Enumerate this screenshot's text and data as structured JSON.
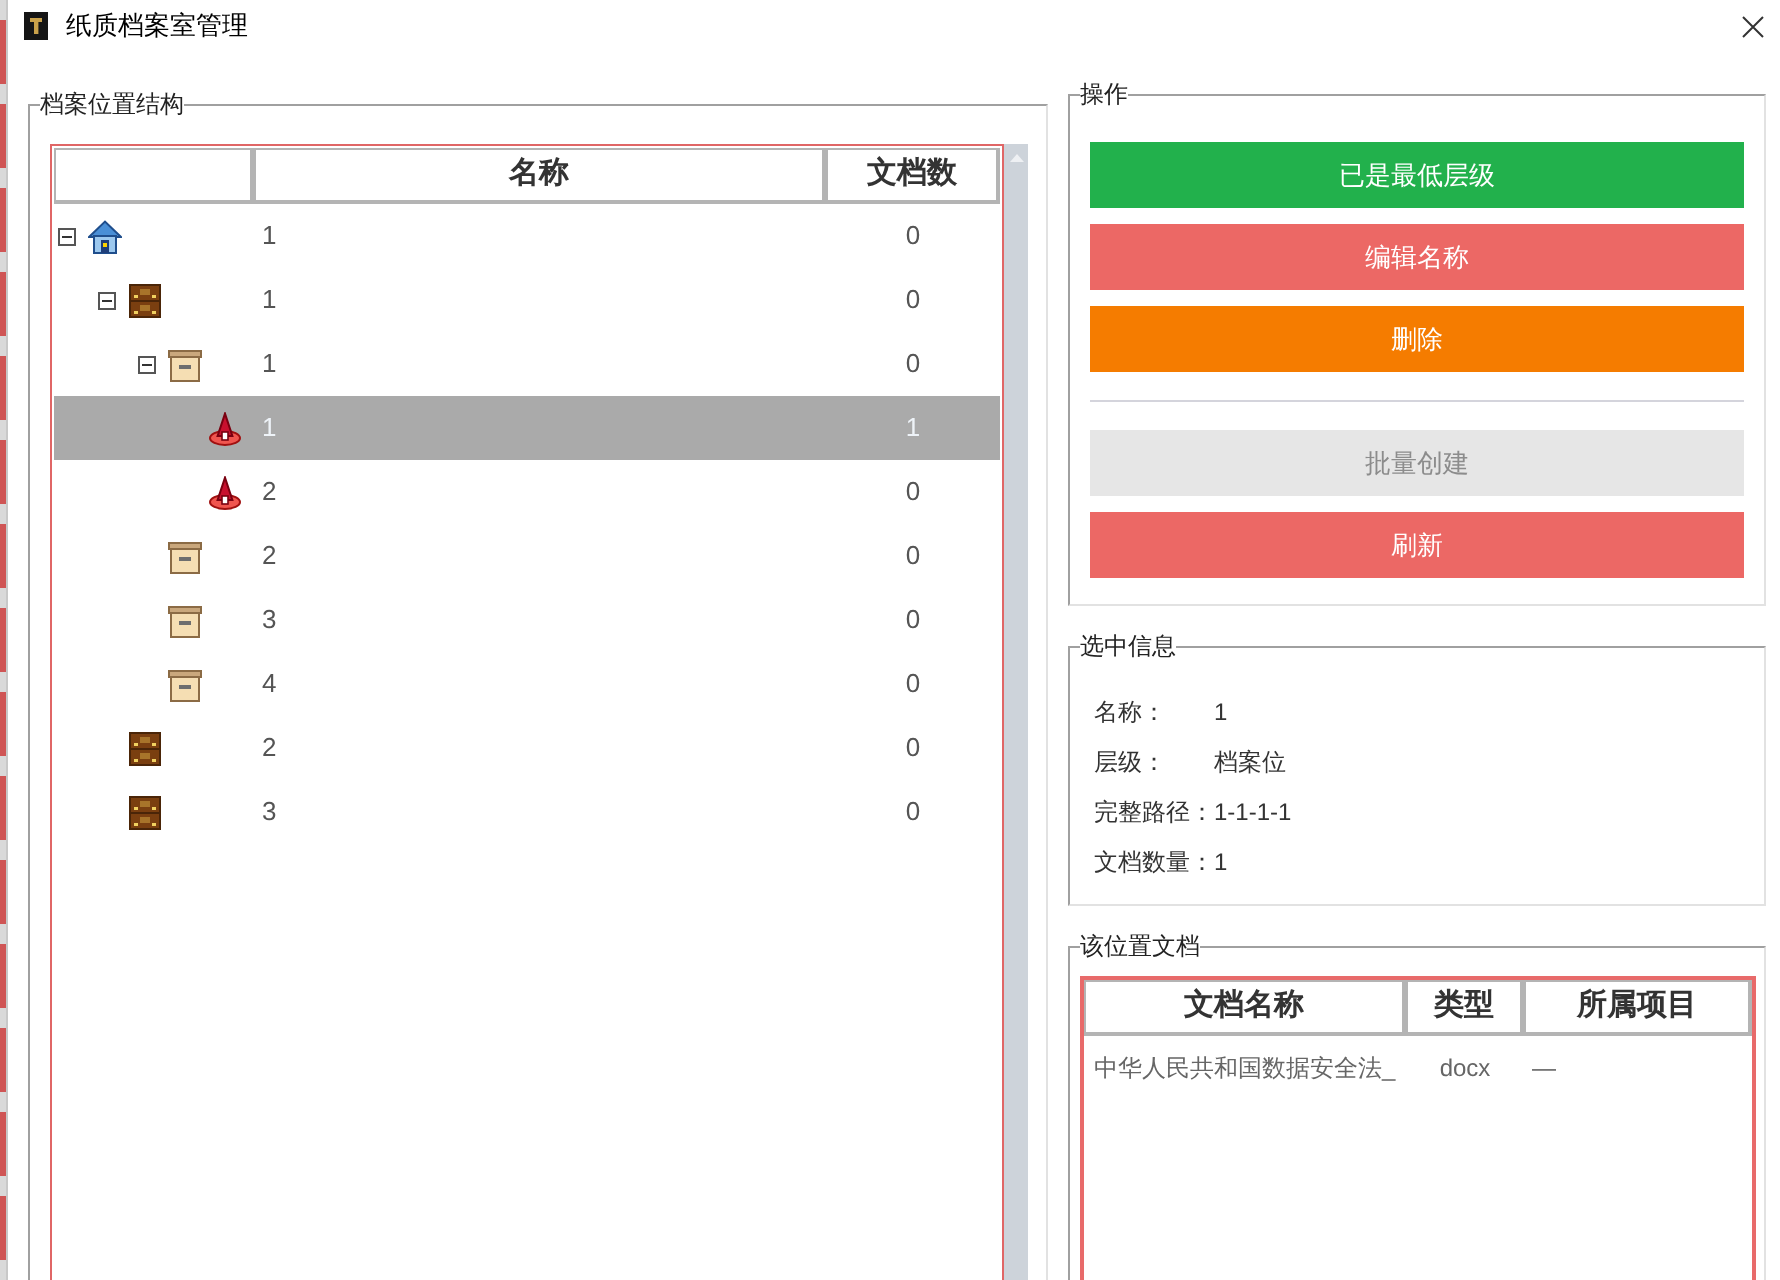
{
  "window": {
    "title": "纸质档案室管理"
  },
  "structure_panel": {
    "title": "档案位置结构",
    "columns": [
      "名称",
      "文档数"
    ],
    "nodes": [
      {
        "kind": "house",
        "name": "1",
        "count": "0",
        "expanded": true,
        "selected": false,
        "children": [
          {
            "kind": "cabinet",
            "name": "1",
            "count": "0",
            "expanded": true,
            "selected": false,
            "children": [
              {
                "kind": "box",
                "name": "1",
                "count": "0",
                "expanded": true,
                "selected": false,
                "children": [
                  {
                    "kind": "pin",
                    "name": "1",
                    "count": "1",
                    "selected": true
                  },
                  {
                    "kind": "pin",
                    "name": "2",
                    "count": "0",
                    "selected": false
                  }
                ]
              },
              {
                "kind": "box",
                "name": "2",
                "count": "0",
                "selected": false
              },
              {
                "kind": "box",
                "name": "3",
                "count": "0",
                "selected": false
              },
              {
                "kind": "box",
                "name": "4",
                "count": "0",
                "selected": false
              }
            ]
          },
          {
            "kind": "cabinet",
            "name": "2",
            "count": "0",
            "selected": false
          },
          {
            "kind": "cabinet",
            "name": "3",
            "count": "0",
            "selected": false
          }
        ]
      }
    ]
  },
  "actions": {
    "title": "操作",
    "groups": [
      [
        {
          "label": "已是最低层级",
          "kind": "success",
          "disabled": false
        },
        {
          "label": "编辑名称",
          "kind": "danger",
          "disabled": false
        },
        {
          "label": "删除",
          "kind": "warning",
          "disabled": false
        }
      ],
      [
        {
          "label": "批量创建",
          "disabled": true
        },
        {
          "label": "刷新",
          "kind": "danger",
          "disabled": false
        }
      ]
    ]
  },
  "selection_info": {
    "title": "选中信息",
    "fields": [
      {
        "label": "名称：",
        "value": "1"
      },
      {
        "label": "层级：",
        "value": "档案位"
      },
      {
        "label": "完整路径：",
        "value": "1-1-1-1"
      },
      {
        "label": "文档数量：",
        "value": "1"
      }
    ]
  },
  "documents": {
    "title": "该位置文档",
    "columns": [
      "文档名称",
      "类型",
      "所属项目"
    ],
    "rows": [
      [
        "中华人民共和国数据安全法_",
        "docx",
        "—"
      ]
    ]
  }
}
